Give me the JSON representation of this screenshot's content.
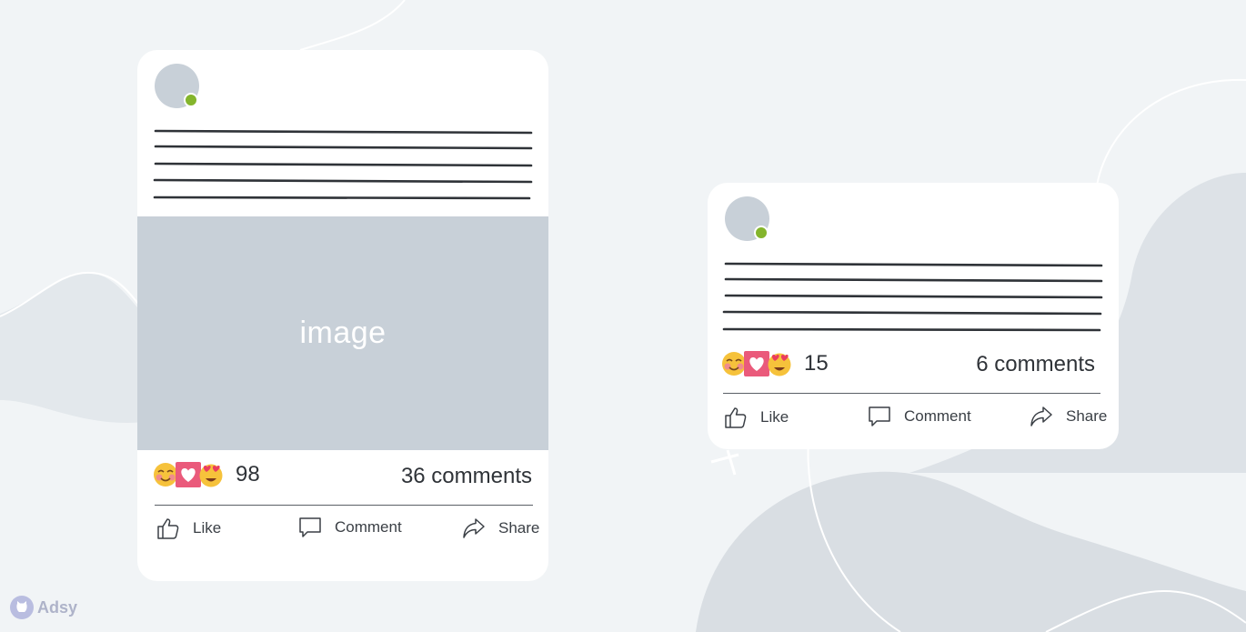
{
  "brand": {
    "name": "Adsy"
  },
  "post_large": {
    "image_placeholder": "image",
    "reactions": {
      "emoji_icons": [
        "smiling-face-icon",
        "heart-icon",
        "heart-eyes-icon"
      ],
      "count": "98"
    },
    "comments_label": "36 comments",
    "actions": {
      "like": "Like",
      "comment": "Comment",
      "share": "Share"
    }
  },
  "post_small": {
    "reactions": {
      "emoji_icons": [
        "smiling-face-icon",
        "heart-icon",
        "heart-eyes-icon"
      ],
      "count": "15"
    },
    "comments_label": "6 comments",
    "actions": {
      "like": "Like",
      "comment": "Comment",
      "share": "Share"
    }
  },
  "colors": {
    "background": "#f1f4f6",
    "placeholder_gray": "#c8d0d8",
    "online_green": "#84b52c",
    "text_dark": "#2f3338"
  }
}
